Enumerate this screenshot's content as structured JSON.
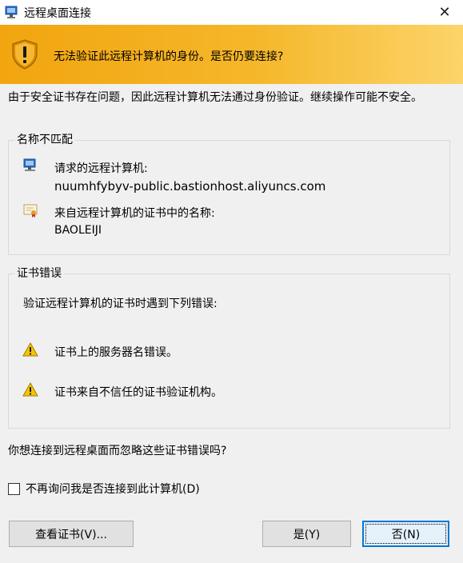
{
  "window": {
    "title": "远程桌面连接",
    "close_glyph": "✕"
  },
  "banner": {
    "icon": "shield-warning-icon",
    "text": "无法验证此远程计算机的身份。是否仍要连接?"
  },
  "description": "由于安全证书存在问题，因此远程计算机无法通过身份验证。继续操作可能不安全。",
  "name_mismatch": {
    "legend": "名称不匹配",
    "requested_label": "请求的远程计算机:",
    "requested_value": "nuumhfybyv-public.bastionhost.aliyuncs.com",
    "cert_label": "来自远程计算机的证书中的名称:",
    "cert_value": "BAOLEIJI"
  },
  "cert_errors": {
    "legend": "证书错误",
    "intro": "验证远程计算机的证书时遇到下列错误:",
    "errors": [
      "证书上的服务器名错误。",
      "证书来自不信任的证书验证机构。"
    ]
  },
  "question": "你想连接到远程桌面而忽略这些证书错误吗?",
  "checkbox": {
    "label": "不再询问我是否连接到此计算机(D)",
    "checked": false
  },
  "buttons": {
    "view_cert": "查看证书(V)...",
    "yes": "是(Y)",
    "no": "否(N)"
  },
  "colors": {
    "banner_start": "#f2a50f",
    "banner_end": "#fcd46a",
    "default_button_border": "#0078d7"
  }
}
